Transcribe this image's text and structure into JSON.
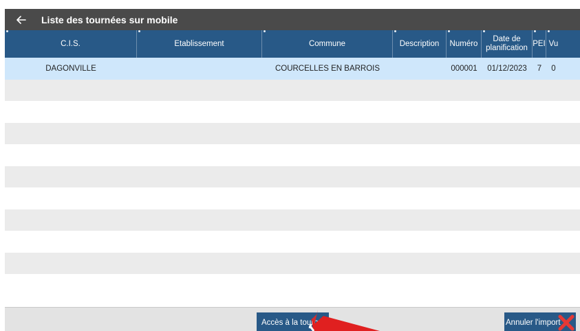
{
  "appbar": {
    "title": "Liste des tournées sur mobile",
    "back_icon": "arrow-left-icon"
  },
  "table": {
    "columns": [
      {
        "label": "C.I.S."
      },
      {
        "label": "Etablissement"
      },
      {
        "label": "Commune"
      },
      {
        "label": "Description"
      },
      {
        "label": "Numéro"
      },
      {
        "label": "Date de planification"
      },
      {
        "label": "PEI"
      },
      {
        "label": "Vu"
      }
    ],
    "rows": [
      [
        "DAGONVILLE",
        "",
        "COURCELLES EN BARROIS",
        "",
        "000001",
        "01/12/2023",
        "7",
        "0"
      ]
    ],
    "empty_rows": 10
  },
  "footer": {
    "access_label": "Accès à la tournée",
    "cancel_label": "Annuler l'import",
    "cancel_icon": "close-x-icon"
  },
  "colors": {
    "header": "#285987",
    "appbar": "#4a4a4a",
    "selected_row": "#cfe7fb",
    "stripe": "#ebebeb",
    "annotation_arrow": "#e02020"
  }
}
